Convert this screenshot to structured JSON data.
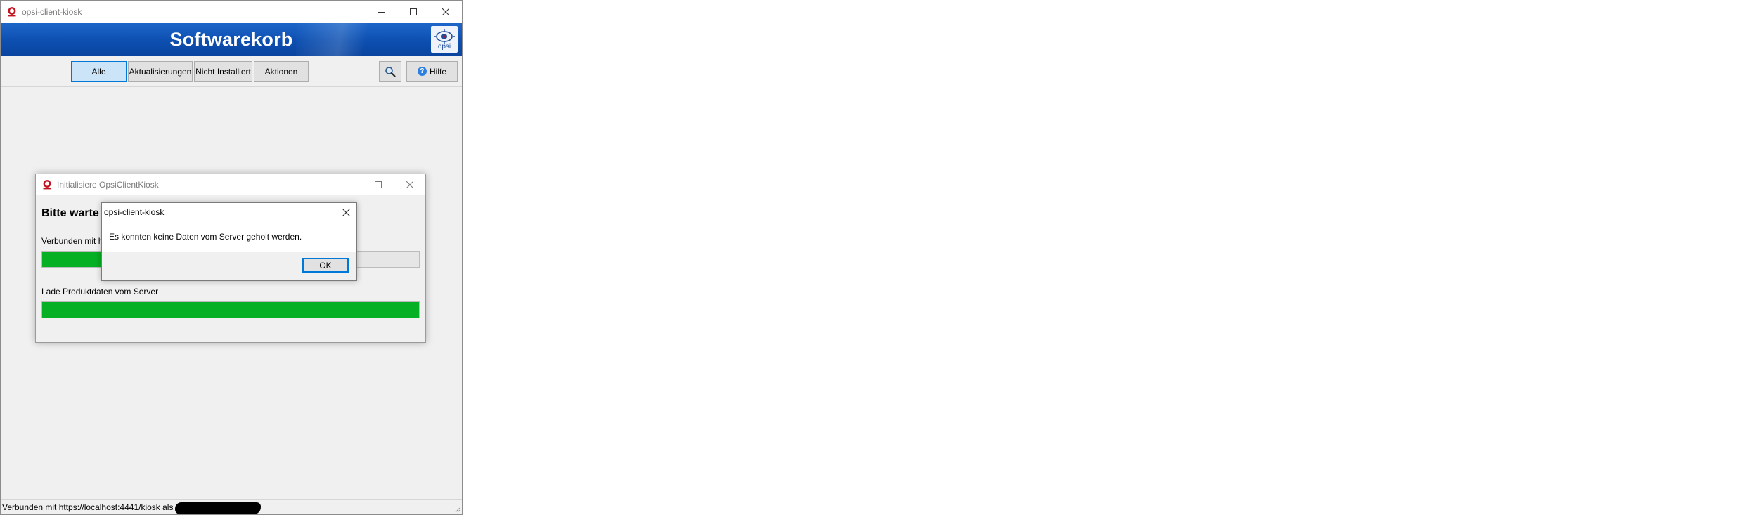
{
  "main_window": {
    "title": "opsi-client-kiosk",
    "banner_title": "Softwarekorb",
    "logo_text": "opsi",
    "filters": [
      {
        "label": "Alle",
        "active": true
      },
      {
        "label": "Aktualisierungen",
        "active": false
      },
      {
        "label": "Nicht Installiert",
        "active": false
      },
      {
        "label": "Aktionen",
        "active": false
      }
    ],
    "help_label": "Hilfe",
    "status_text": "Verbunden mit https://localhost:4441/kiosk als"
  },
  "init_dialog": {
    "title": "Initialisiere OpsiClientKiosk",
    "heading": "Bitte warte",
    "connected_label": "Verbunden mit h",
    "connected_progress": 0.16,
    "load_label": "Lade Produktdaten vom Server",
    "load_progress": 1.0
  },
  "error_dialog": {
    "title": "opsi-client-kiosk",
    "message": "Es konnten keine Daten vom Server geholt werden.",
    "ok_label": "OK"
  },
  "colors": {
    "banner": "#0d4fb0",
    "progress": "#06b025",
    "accent": "#0078d7",
    "active_filter": "#cce4f7"
  },
  "icons": [
    "opsi-app-icon",
    "minimize-icon",
    "maximize-icon",
    "close-icon",
    "search-icon",
    "help-icon",
    "opsi-logo",
    "resize-grip-icon"
  ]
}
